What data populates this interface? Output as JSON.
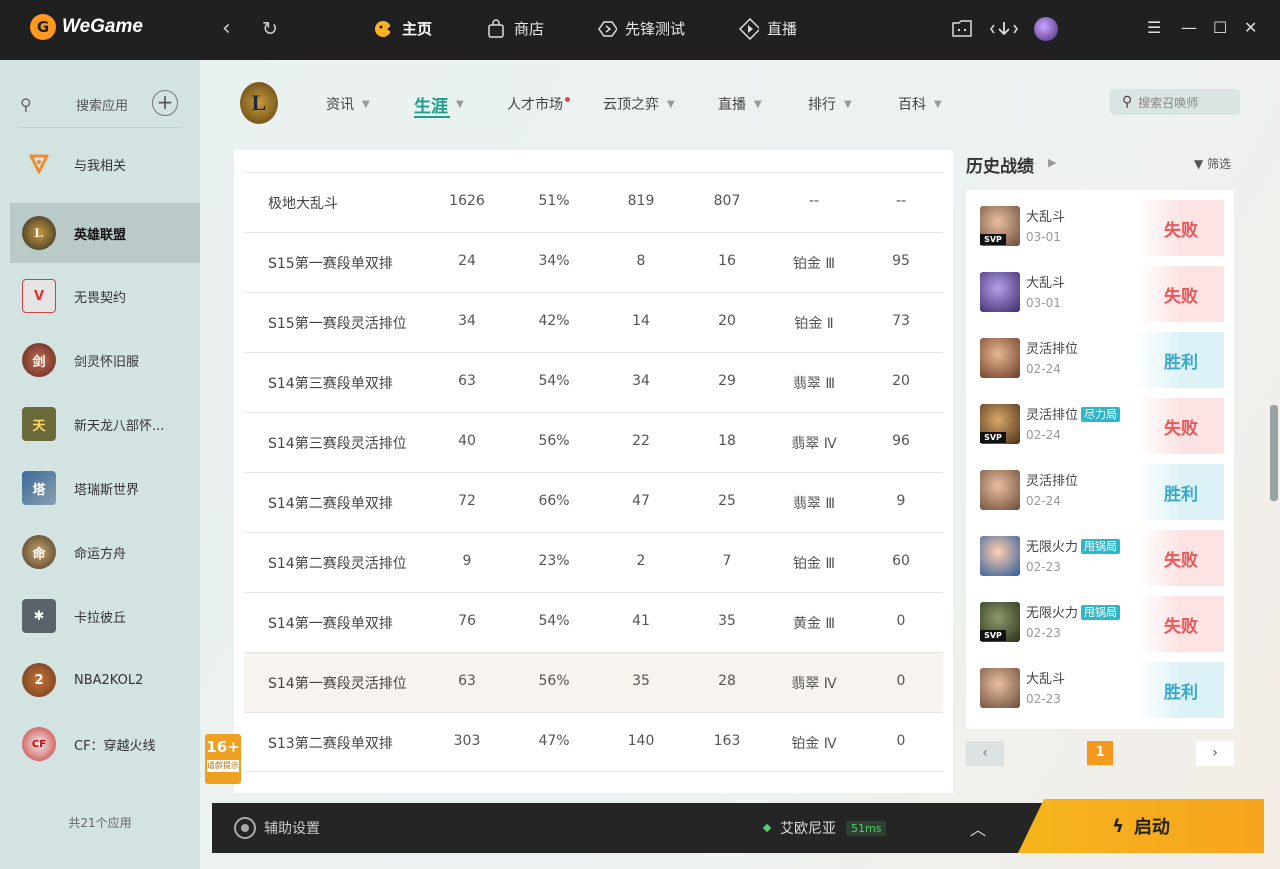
{
  "app": {
    "name": "WeGame"
  },
  "topnav": [
    {
      "label": "主页",
      "icon": "home-face-icon"
    },
    {
      "label": "商店",
      "icon": "shop-bag-icon"
    },
    {
      "label": "先锋测试",
      "icon": "pioneer-test-icon"
    },
    {
      "label": "直播",
      "icon": "live-play-icon"
    }
  ],
  "sidebar": {
    "search_label": "搜索应用",
    "items": [
      {
        "label": "与我相关"
      },
      {
        "label": "英雄联盟"
      },
      {
        "label": "无畏契约"
      },
      {
        "label": "剑灵怀旧服"
      },
      {
        "label": "新天龙八部怀..."
      },
      {
        "label": "塔瑞斯世界"
      },
      {
        "label": "命运方舟"
      },
      {
        "label": "卡拉彼丘"
      },
      {
        "label": "NBA2KOL2"
      },
      {
        "label": "CF：穿越火线"
      }
    ],
    "count": "共21个应用"
  },
  "subnav": [
    {
      "label": "资讯"
    },
    {
      "label": "生涯"
    },
    {
      "label": "人才市场"
    },
    {
      "label": "云顶之弈"
    },
    {
      "label": "直播"
    },
    {
      "label": "排行"
    },
    {
      "label": "百科"
    }
  ],
  "summoner_search": {
    "placeholder": "搜索召唤师"
  },
  "career_table": {
    "rows": [
      [
        "极地大乱斗",
        "1626",
        "51%",
        "819",
        "807",
        "--",
        "--"
      ],
      [
        "S15第一赛段单双排",
        "24",
        "34%",
        "8",
        "16",
        "铂金 Ⅲ",
        "95"
      ],
      [
        "S15第一赛段灵活排位",
        "34",
        "42%",
        "14",
        "20",
        "铂金 Ⅱ",
        "73"
      ],
      [
        "S14第三赛段单双排",
        "63",
        "54%",
        "34",
        "29",
        "翡翠 Ⅲ",
        "20"
      ],
      [
        "S14第三赛段灵活排位",
        "40",
        "56%",
        "22",
        "18",
        "翡翠 Ⅳ",
        "96"
      ],
      [
        "S14第二赛段单双排",
        "72",
        "66%",
        "47",
        "25",
        "翡翠 Ⅲ",
        "9"
      ],
      [
        "S14第二赛段灵活排位",
        "9",
        "23%",
        "2",
        "7",
        "铂金 Ⅲ",
        "60"
      ],
      [
        "S14第一赛段单双排",
        "76",
        "54%",
        "41",
        "35",
        "黄金 Ⅲ",
        "0"
      ],
      [
        "S14第一赛段灵活排位",
        "63",
        "56%",
        "35",
        "28",
        "翡翠 Ⅳ",
        "0"
      ],
      [
        "S13第二赛段单双排",
        "303",
        "47%",
        "140",
        "163",
        "铂金 Ⅳ",
        "0"
      ]
    ]
  },
  "history": {
    "title": "历史战绩",
    "filter": "筛选",
    "matches": [
      {
        "mode": "大乱斗",
        "tag": "",
        "date": "03-01",
        "result": "失败",
        "svp": "SVP",
        "color": "#b08060"
      },
      {
        "mode": "大乱斗",
        "tag": "",
        "date": "03-01",
        "result": "失败",
        "svp": "",
        "color": "#5a4a8a"
      },
      {
        "mode": "灵活排位",
        "tag": "",
        "date": "02-24",
        "result": "胜利",
        "svp": "",
        "color": "#a06040"
      },
      {
        "mode": "灵活排位",
        "tag": "尽力局",
        "date": "02-24",
        "result": "失败",
        "svp": "SVP",
        "color": "#806030"
      },
      {
        "mode": "灵活排位",
        "tag": "",
        "date": "02-24",
        "result": "胜利",
        "svp": "",
        "color": "#b07858"
      },
      {
        "mode": "无限火力",
        "tag": "甩锅局",
        "date": "02-23",
        "result": "失败",
        "svp": "",
        "color": "#3a7ab8"
      },
      {
        "mode": "无限火力",
        "tag": "甩锅局",
        "date": "02-23",
        "result": "失败",
        "svp": "SVP",
        "color": "#4a5a3a"
      },
      {
        "mode": "大乱斗",
        "tag": "",
        "date": "02-23",
        "result": "胜利",
        "svp": "",
        "color": "#a87050"
      }
    ],
    "page": "1"
  },
  "age_badge": {
    "age": "16+",
    "note": "适龄提示"
  },
  "bottombar": {
    "assist": "辅助设置",
    "server": "艾欧尼亚",
    "ping": "51ms",
    "launch": "启动"
  }
}
